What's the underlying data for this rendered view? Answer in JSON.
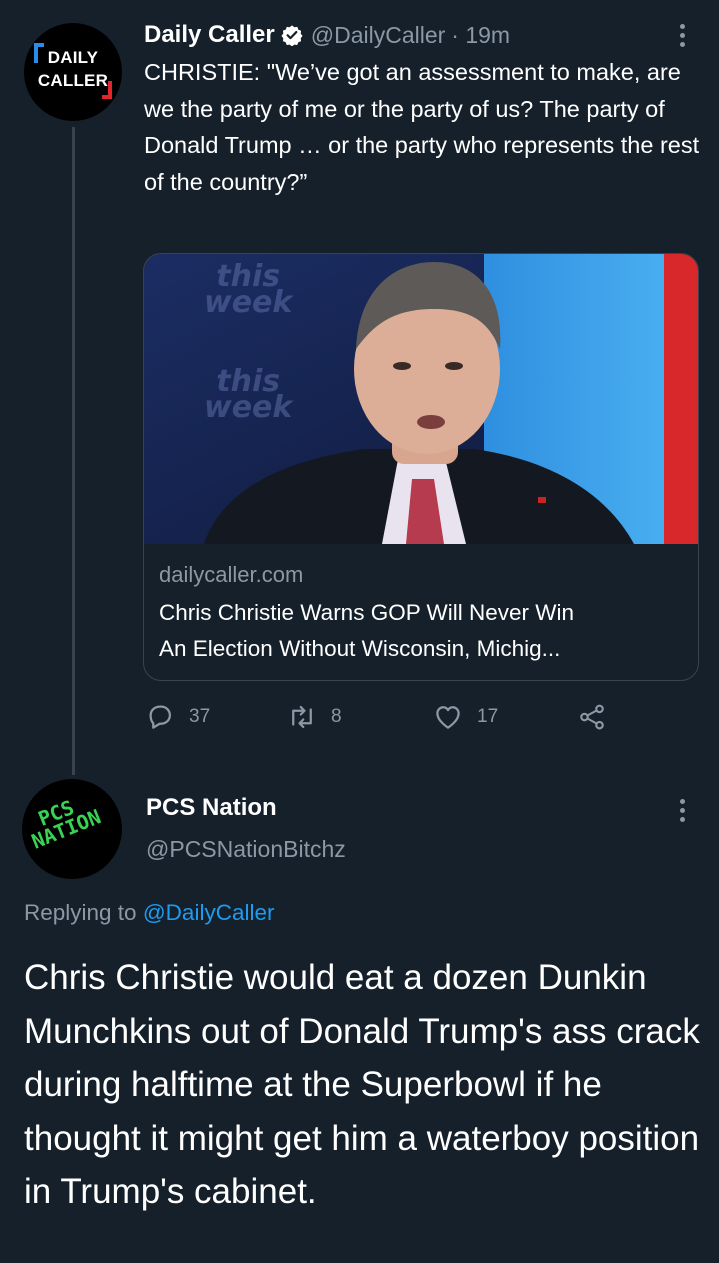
{
  "tweet1": {
    "author_name": "Daily Caller",
    "author_handle": "@DailyCaller",
    "time": "· 19m",
    "avatar_logo": {
      "line1": "DAILY",
      "line2": "CALLER"
    },
    "text": "CHRISTIE: \"We’ve got an assessment to make, are we the party of me or the party of us? The party of Donald Trump … or the party who represents the rest of the country?”",
    "card": {
      "image_overlay": {
        "line1": "this",
        "line2": "week"
      },
      "domain": "dailycaller.com",
      "title_line1": "Chris Christie Warns GOP Will Never Win",
      "title_line2": "An Election Without Wisconsin, Michig..."
    },
    "actions": {
      "replies": "37",
      "retweets": "8",
      "likes": "17"
    }
  },
  "tweet2": {
    "author_name": "PCS Nation",
    "author_handle": "@PCSNationBitchz",
    "avatar_logo": {
      "line1": "PCS",
      "line2": "NATION"
    },
    "replying_to_prefix": "Replying to",
    "replying_to_handle": "@DailyCaller",
    "text": "Chris Christie would eat a dozen Dunkin Munchkins out of Donald Trump's ass crack during halftime at the Superbowl if he thought it might get him a waterboy position in Trump's cabinet."
  },
  "colors": {
    "background": "#15202b",
    "secondary_text": "#8b98a5",
    "accent_blue": "#1d9bf0",
    "border": "#38444d",
    "pcs_green": "#39d353",
    "dc_red": "#e0262a",
    "dc_blue": "#2b8be8"
  },
  "icons": [
    "verified-badge-icon",
    "more-icon",
    "reply-icon",
    "retweet-icon",
    "like-icon",
    "share-icon"
  ]
}
